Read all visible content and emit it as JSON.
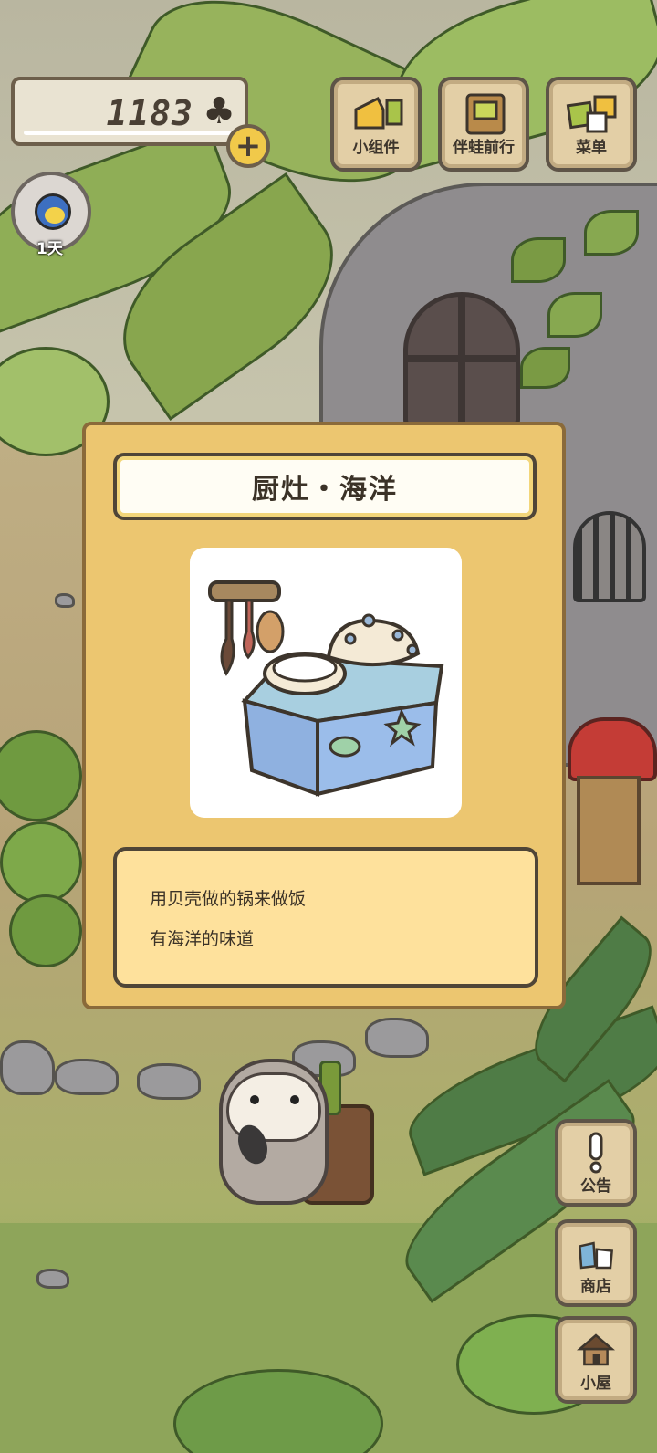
{
  "hud": {
    "clover_count": "1183",
    "clover_icon": "clover-icon",
    "add_label": "+",
    "day_label": "1天"
  },
  "top_buttons": [
    {
      "label": "小组件",
      "icon": "widget-icon"
    },
    {
      "label": "伴蛙前行",
      "icon": "journey-book-icon"
    },
    {
      "label": "菜单",
      "icon": "menu-cards-icon"
    }
  ],
  "side_buttons": [
    {
      "label": "公告",
      "icon": "exclamation-icon"
    },
    {
      "label": "商店",
      "icon": "shop-bags-icon"
    },
    {
      "label": "小屋",
      "icon": "house-icon"
    }
  ],
  "item_modal": {
    "title": "厨灶・海洋",
    "image_icon": "shell-kitchen-stove-icon",
    "description_lines": [
      "用贝壳做的锅来做饭",
      "有海洋的味道"
    ]
  },
  "colors": {
    "modal_bg": "#ecc670",
    "desc_bg": "#fee19c",
    "button_bg": "#e3cfa6",
    "outline": "#4f4537"
  }
}
